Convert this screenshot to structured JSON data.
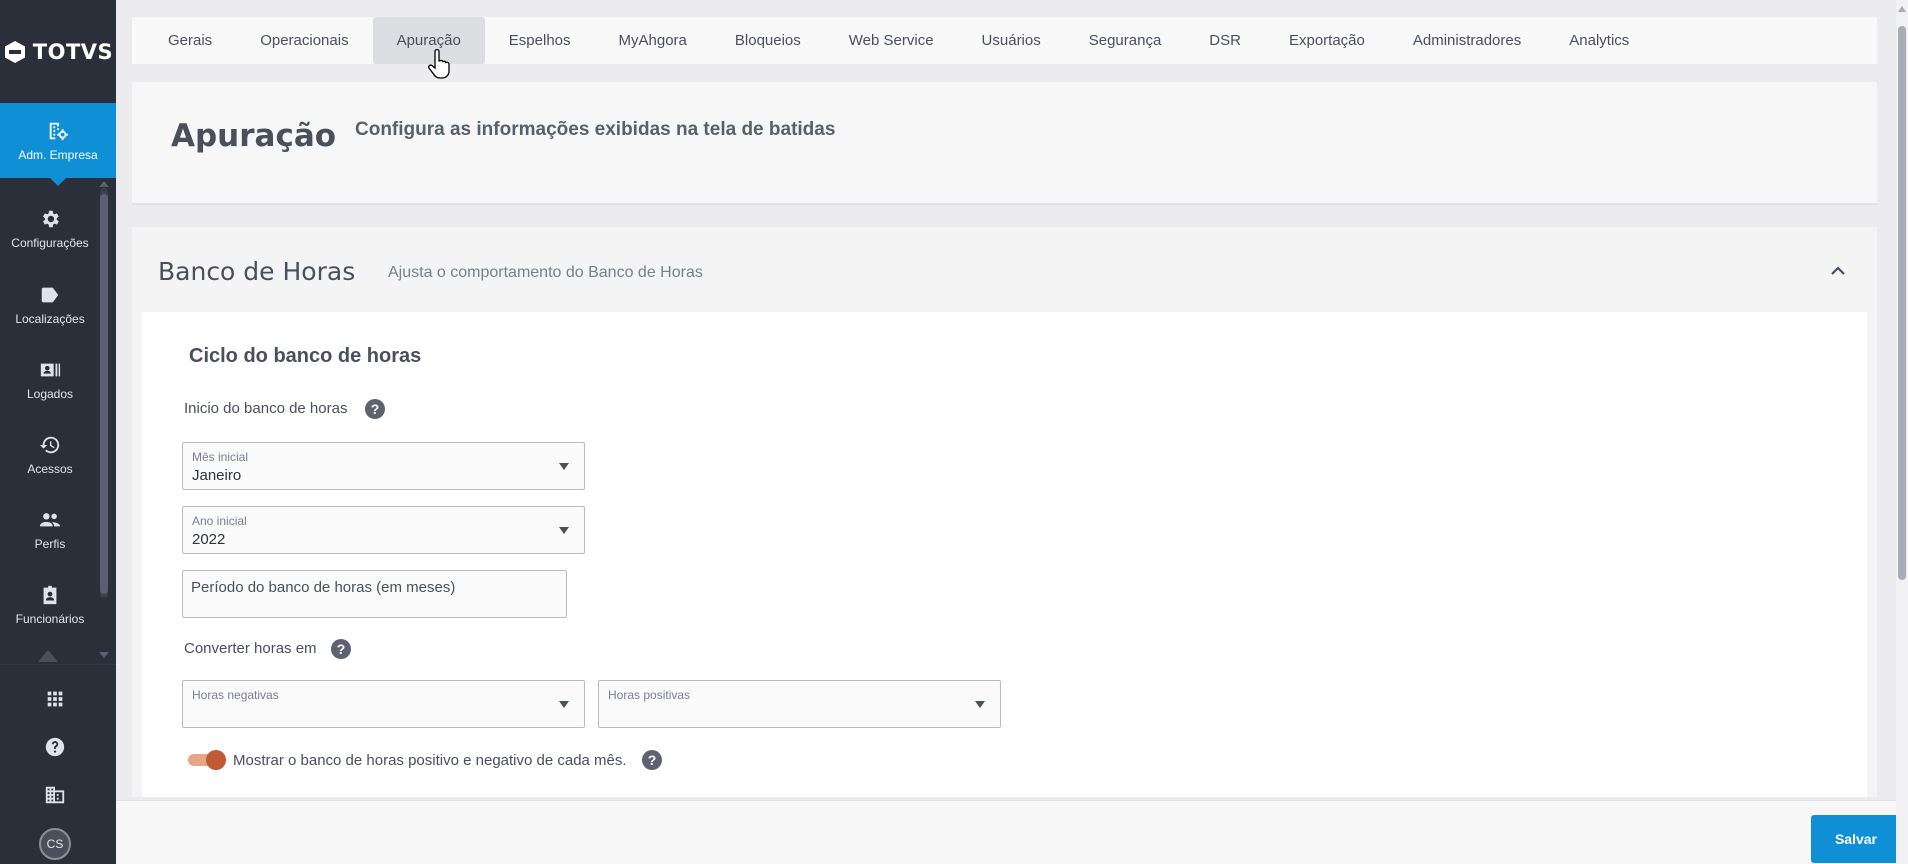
{
  "brand": {
    "logo_text": "TOTVS"
  },
  "sidebar": {
    "active": {
      "label": "Adm. Empresa",
      "icon": "building-gear-icon"
    },
    "items": [
      {
        "label": "Configurações",
        "icon": "gear-icon"
      },
      {
        "label": "Localizações",
        "icon": "tag-icon"
      },
      {
        "label": "Logados",
        "icon": "id-card-icon"
      },
      {
        "label": "Acessos",
        "icon": "history-icon"
      },
      {
        "label": "Perfis",
        "icon": "people-icon"
      },
      {
        "label": "Funcionários",
        "icon": "badge-icon"
      }
    ],
    "bottom": [
      {
        "icon": "apps-grid-icon"
      },
      {
        "icon": "help-circle-icon"
      },
      {
        "icon": "company-building-icon"
      }
    ],
    "avatar_initials": "CS"
  },
  "tabs": [
    {
      "label": "Gerais",
      "active": false
    },
    {
      "label": "Operacionais",
      "active": false
    },
    {
      "label": "Apuração",
      "active": true
    },
    {
      "label": "Espelhos",
      "active": false
    },
    {
      "label": "MyAhgora",
      "active": false
    },
    {
      "label": "Bloqueios",
      "active": false
    },
    {
      "label": "Web Service",
      "active": false
    },
    {
      "label": "Usuários",
      "active": false
    },
    {
      "label": "Segurança",
      "active": false
    },
    {
      "label": "DSR",
      "active": false
    },
    {
      "label": "Exportação",
      "active": false
    },
    {
      "label": "Administradores",
      "active": false
    },
    {
      "label": "Analytics",
      "active": false
    }
  ],
  "header": {
    "title": "Apuração",
    "subtitle": "Configura as informações exibidas na tela de batidas"
  },
  "section": {
    "title": "Banco de Horas",
    "description": "Ajusta o comportamento do Banco de Horas",
    "group_title": "Ciclo do banco de horas",
    "start_label": "Inicio do banco de horas",
    "month_select": {
      "label": "Mês inicial",
      "value": "Janeiro"
    },
    "year_select": {
      "label": "Ano inicial",
      "value": "2022"
    },
    "period_input": {
      "placeholder": "Período do banco de horas (em meses)"
    },
    "convert_label": "Converter horas em",
    "negative_select": {
      "label": "Horas negativas",
      "value": ""
    },
    "positive_select": {
      "label": "Horas positivas",
      "value": ""
    },
    "toggle": {
      "label": "Mostrar o banco de horas positivo e negativo de cada mês.",
      "on": true
    }
  },
  "actions": {
    "save_label": "Salvar"
  },
  "colors": {
    "accent": "#0e8fd6",
    "sidebar": "#2b2f3a",
    "toggle_knob": "#c15a33",
    "toggle_track": "#e8a688"
  }
}
